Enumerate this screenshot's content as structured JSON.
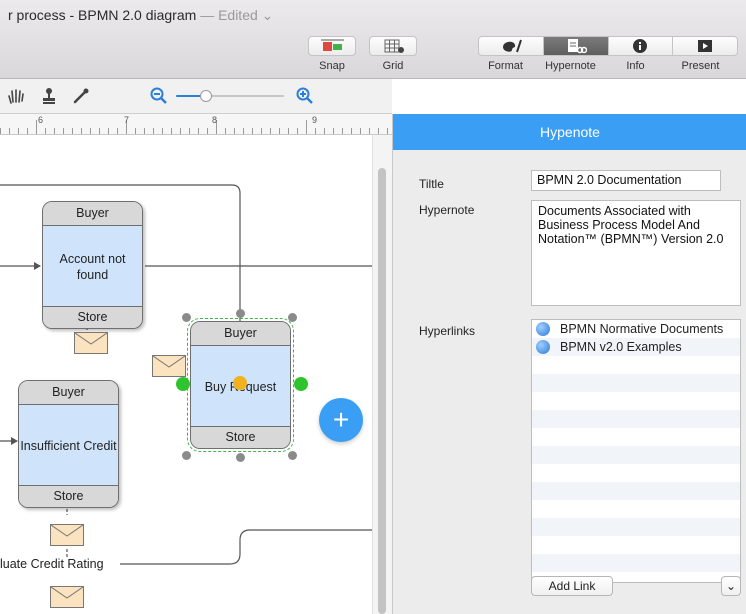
{
  "window": {
    "title": "r process - BPMN 2.0 diagram",
    "edited": "— Edited ⌄"
  },
  "toolbar": {
    "snap_label": "Snap",
    "grid_label": "Grid",
    "segments": [
      {
        "label": "Format",
        "icon": "palette-icon"
      },
      {
        "label": "Hypernote",
        "icon": "hypernote-icon"
      },
      {
        "label": "Info",
        "icon": "info-icon"
      },
      {
        "label": "Present",
        "icon": "present-icon"
      }
    ]
  },
  "tools": [
    "hand-tool-icon",
    "stamp-tool-icon",
    "eyedropper-tool-icon"
  ],
  "zoom": {
    "level_fraction": 0.25
  },
  "ruler": {
    "marks": [
      "6",
      "7",
      "8",
      "9"
    ]
  },
  "canvas": {
    "tasks": [
      {
        "participant": "Buyer",
        "name": "Account not found",
        "initiator": "Store"
      },
      {
        "participant": "Buyer",
        "name": "Buy Request",
        "initiator": "Store"
      },
      {
        "participant": "Buyer",
        "name": "Insufficient Credit",
        "initiator": "Store"
      }
    ],
    "partial_label": "luate Credit Rating",
    "add_label": "+"
  },
  "panel": {
    "header": "Hypenote",
    "title_label": "Tiltle",
    "title_value": "BPMN 2.0 Documentation",
    "hypernote_label": "Hypernote",
    "hypernote_value": "Documents Associated with Business Process Model And Notation™ (BPMN™) Version 2.0",
    "hyperlinks_label": "Hyperlinks",
    "links": [
      "BPMN Normative Documents",
      "BPMN v2.0 Examples"
    ],
    "add_link_label": "Add Link",
    "dropdown_glyph": "⌄"
  },
  "colors": {
    "accent": "#3a9ff4",
    "task_fill": "#cfe4fb",
    "task_band": "#d8d8d8",
    "envelope": "#fbe3bf",
    "connector": "#2ec42e"
  }
}
